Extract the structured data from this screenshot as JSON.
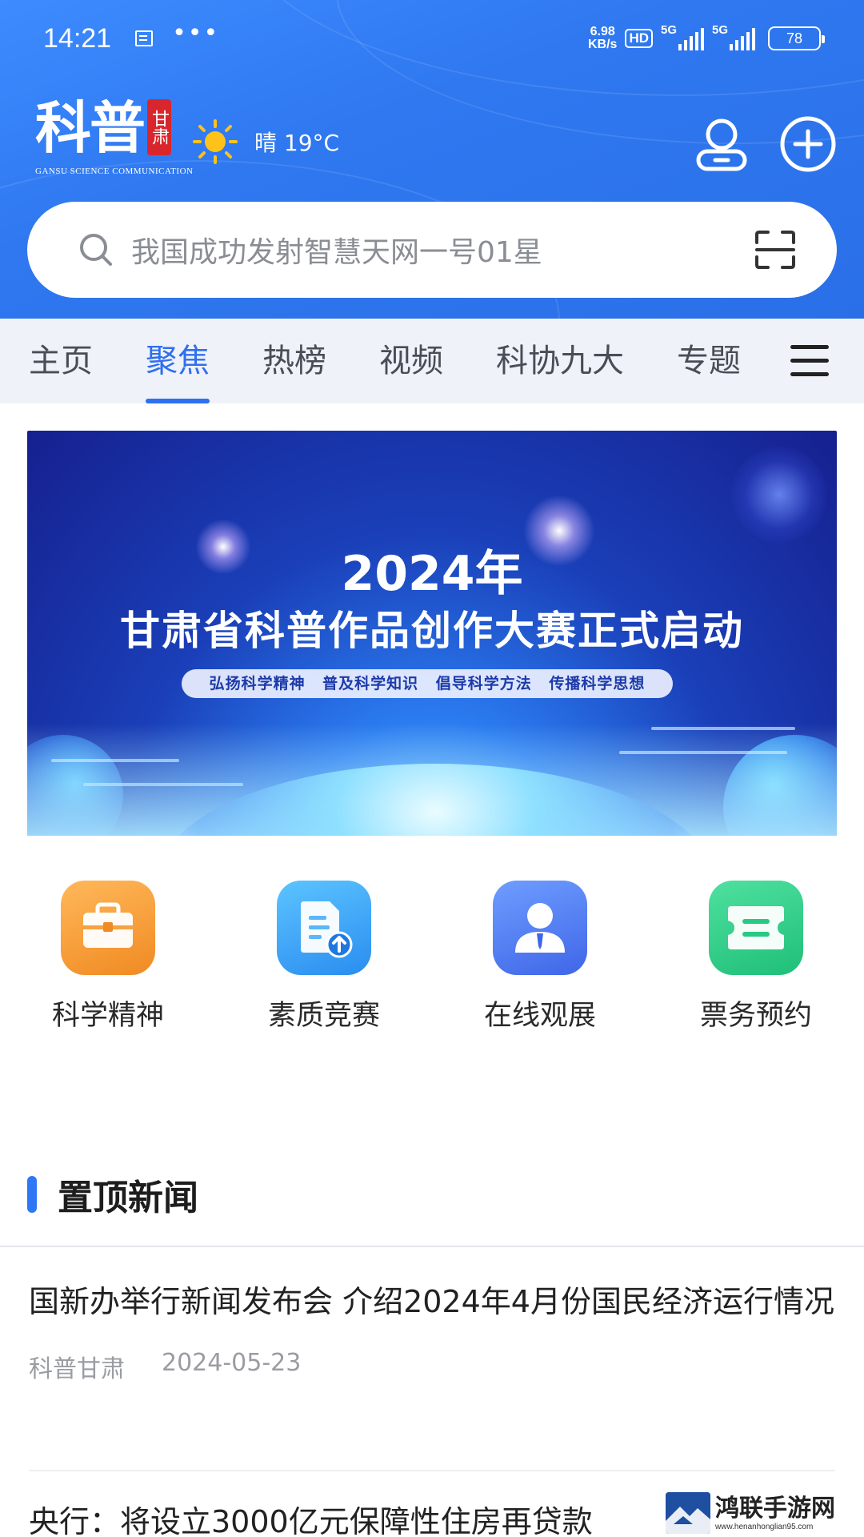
{
  "status_bar": {
    "time": "14:21",
    "net_speed_value": "6.98",
    "net_speed_unit": "KB/s",
    "hd_label": "HD",
    "signal1_label": "5G",
    "signal2_label": "5G",
    "battery": "78"
  },
  "header": {
    "brand_title": "科普",
    "brand_seal": "甘肃",
    "brand_subtitle": "GANSU SCIENCE COMMUNICATION",
    "weather_icon": "sun-icon",
    "weather_text": "晴 19°C",
    "user_icon": "user-icon",
    "add_icon": "plus-circle-icon"
  },
  "search": {
    "placeholder": "我国成功发射智慧天网一号01星",
    "scan_icon": "scan-icon"
  },
  "tabs": [
    {
      "label": "主页",
      "active": false
    },
    {
      "label": "聚焦",
      "active": true
    },
    {
      "label": "热榜",
      "active": false
    },
    {
      "label": "视频",
      "active": false
    },
    {
      "label": "科协九大",
      "active": false
    },
    {
      "label": "专题",
      "active": false
    }
  ],
  "banner": {
    "year": "2024年",
    "title": "甘肃省科普作品创作大赛正式启动",
    "slogan": "弘扬科学精神  普及科学知识  倡导科学方法  传播科学思想"
  },
  "quick_entries": [
    {
      "label": "科学精神",
      "icon": "briefcase-icon",
      "color": "#f39a36"
    },
    {
      "label": "素质竞赛",
      "icon": "document-upload-icon",
      "color": "#3ba6f7"
    },
    {
      "label": "在线观展",
      "icon": "person-icon",
      "color": "#4a78f0"
    },
    {
      "label": "票务预约",
      "icon": "ticket-icon",
      "color": "#2fcf8a"
    }
  ],
  "section": {
    "title": "置顶新闻"
  },
  "news": [
    {
      "title": "国新办举行新闻发布会 介绍2024年4月份国民经济运行情况",
      "source": "科普甘肃",
      "date": "2024-05-23"
    },
    {
      "title": "央行：将设立3000亿元保障性住房再贷款"
    }
  ],
  "watermark": {
    "name": "鸿联手游网",
    "url": "www.henanhonglian95.com"
  },
  "colors": {
    "header_blue": "#2f78f0",
    "accent": "#2f6ff0",
    "tab_bg": "#eff2f8"
  }
}
